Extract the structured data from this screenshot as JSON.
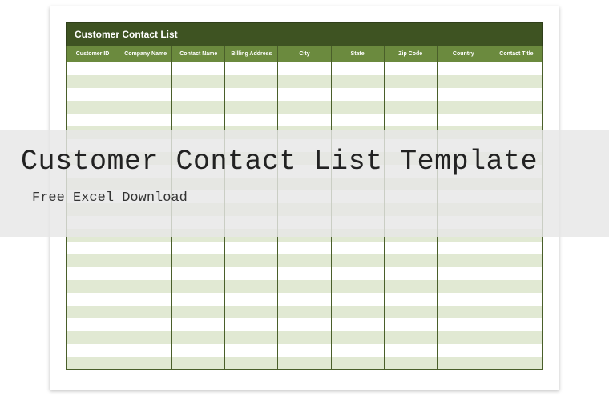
{
  "sheet": {
    "title": "Customer Contact List",
    "columns": [
      "Customer ID",
      "Company Name",
      "Contact Name",
      "Billing Address",
      "City",
      "State",
      "Zip Code",
      "Country",
      "Contact Title"
    ],
    "row_count": 24
  },
  "overlay": {
    "title": "Customer Contact List Template",
    "subtitle": "Free Excel Download"
  }
}
